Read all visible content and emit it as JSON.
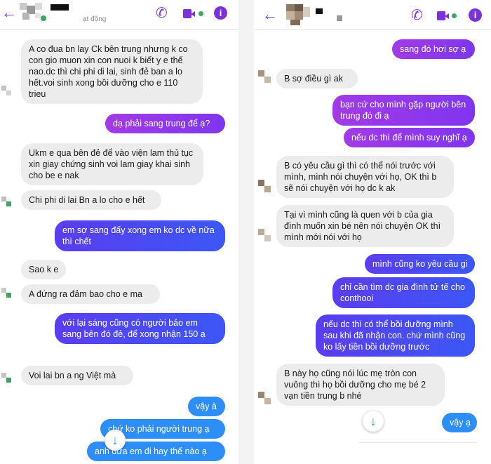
{
  "left": {
    "header": {
      "status": "ạt động"
    },
    "messages": [
      "A co đua bn lay Ck bên trung nhưng k co con gio muon xin con nuoi k biết y e thế nao.dc thì chi phi di lai, sinh đẻ ban a lo hết.voi sinh xong bồi dưỡng cho e 110 trieu",
      "dạ phải sang trung để ạ?",
      "Ukm e qua bên đẻ để vào viện lam thủ tục xin giay chứng sinh voi lam giay khai sinh cho be e nak",
      "Chi phi di lai Bn a lo cho e hết",
      "em sợ sang đấy xong em ko dc về nữa thì chết",
      "Sao k e",
      "A đứng ra đảm bao cho e ma",
      "với lại sáng cũng có người bảo em sang bên đó đẻ, để xong nhận 150 ạ",
      "Voi lai bn a ng Việt mà",
      "vậy à",
      "chứ ko phải người trung ạ",
      "anh đưa em đi hay thế nào ạ"
    ]
  },
  "right": {
    "messages": [
      "sang đó hơi sợ ạ",
      "B sợ điều gì ak",
      "bạn cứ cho mình gặp người bên trung đó đi ạ",
      "nếu dc thì để mình suy nghĩ ạ",
      "B có yêu cầu gì thì có thể nói trước với mình, mình nói chuyện với họ, OK thì b sẽ nói chuyện với họ dc k ak",
      "Tại vì mình cũng là quen với b của gia đình muốn xin bé nên nói chuyện OK thì mình mới nói với họ",
      "mình cũng ko yêu cầu gì",
      "chỉ cần tìm dc gia đình tử tế cho conthooi",
      "nếu dc thì có thể bồi dưỡng mình sau khi đã nhận con. chứ mình cũng ko lấy tiền bồi dưỡng trước",
      "B này họ cũng nói lúc mẹ tròn con vuông thì họ bồi dưỡng cho mẹ bé 2 vạn tiền trung b nhé",
      "vậy ạ"
    ]
  },
  "icons": {
    "back": "←",
    "phone": "✆",
    "video": "■",
    "info": "i",
    "scroll_down": "↓"
  },
  "colors": {
    "accent_purple": "#7b32d6",
    "bubble_purple": "#9b38e8",
    "bubble_blue": "#3c57f5",
    "bubble_light_blue": "#2e8ef7",
    "incoming_gray": "#ececec"
  }
}
